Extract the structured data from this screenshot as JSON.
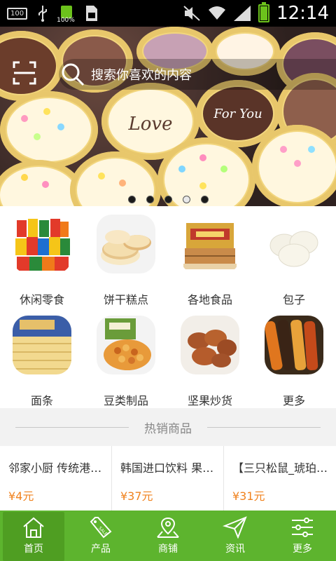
{
  "status_bar": {
    "sd_label": "100",
    "battery_small_label": "100%",
    "time": "12:14"
  },
  "search": {
    "placeholder": "搜索你喜欢的内容"
  },
  "banner": {
    "cup_texts": [
      "Love",
      "For You"
    ],
    "slide_count": 5,
    "active_slide": 4
  },
  "categories": [
    {
      "label": "休闲零食",
      "icon": "snacks-image"
    },
    {
      "label": "饼干糕点",
      "icon": "pastry-image"
    },
    {
      "label": "各地食品",
      "icon": "regional-food-image"
    },
    {
      "label": "包子",
      "icon": "bun-image"
    },
    {
      "label": "面条",
      "icon": "noodles-image"
    },
    {
      "label": "豆类制品",
      "icon": "beans-image"
    },
    {
      "label": "坚果炒货",
      "icon": "nuts-image"
    },
    {
      "label": "更多",
      "icon": "more-image"
    }
  ],
  "hot": {
    "title": "热销商品"
  },
  "products": [
    {
      "title": "邻家小厨 传统港式点心",
      "price": "¥4元"
    },
    {
      "title": "韩国进口饮料 果汁饮品",
      "price": "¥37元"
    },
    {
      "title": "【三只松鼠_琥珀核桃仁",
      "price": "¥31元"
    }
  ],
  "tabbar": [
    {
      "label": "首页",
      "icon": "home-icon",
      "active": true
    },
    {
      "label": "产品",
      "icon": "tag-icon",
      "active": false
    },
    {
      "label": "商铺",
      "icon": "map-icon",
      "active": false
    },
    {
      "label": "资讯",
      "icon": "send-icon",
      "active": false
    },
    {
      "label": "更多",
      "icon": "sliders-icon",
      "active": false
    }
  ],
  "colors": {
    "accent_green": "#5db42e",
    "price_orange": "#f0821e"
  }
}
